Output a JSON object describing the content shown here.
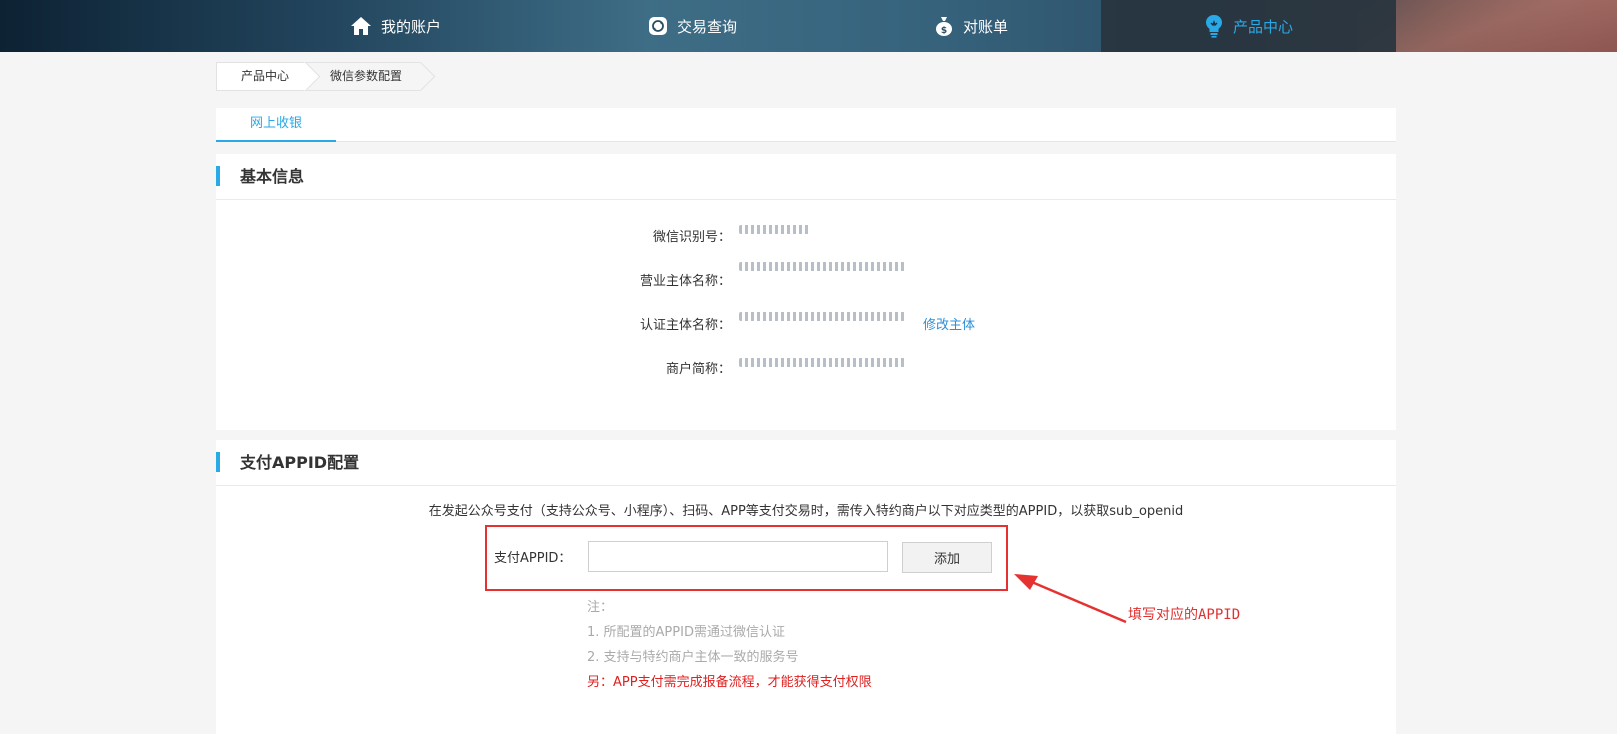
{
  "nav": {
    "items": [
      {
        "label": "我的账户",
        "icon": "home-icon"
      },
      {
        "label": "交易查询",
        "icon": "exchange-icon"
      },
      {
        "label": "对账单",
        "icon": "money-bag-icon"
      },
      {
        "label": "产品中心",
        "icon": "lightbulb-icon",
        "active": true
      }
    ],
    "active_color": "#29a9e6"
  },
  "breadcrumb": {
    "items": [
      "产品中心",
      "微信参数配置"
    ]
  },
  "tabs": {
    "items": [
      "网上收银"
    ]
  },
  "basic_info": {
    "title": "基本信息",
    "rows": [
      {
        "label": "微信识别号："
      },
      {
        "label": "营业主体名称："
      },
      {
        "label": "认证主体名称：",
        "action": "修改主体"
      },
      {
        "label": "商户简称："
      }
    ]
  },
  "appid_config": {
    "title": "支付APPID配置",
    "description": "在发起公众号支付（支持公众号、小程序）、扫码、APP等支付交易时，需传入特约商户以下对应类型的APPID，以获取sub_openid",
    "field_label": "支付APPID：",
    "field_value": "",
    "add_button": "添加",
    "notes": {
      "heading": "注：",
      "items": [
        "1. 所配置的APPID需通过微信认证",
        "2. 支持与特约商户主体一致的服务号"
      ],
      "warning": "另：APP支付需完成报备流程，才能获得支付权限"
    }
  },
  "annotation": {
    "text": "填写对应的APPID",
    "color": "#e03030"
  }
}
